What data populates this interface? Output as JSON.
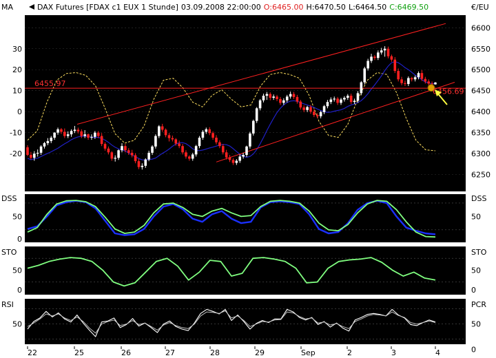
{
  "header": {
    "symbol": "DAX Futures [FDAX c1 EUX  1 Stunde]",
    "datetime": "03.09.2008 22:00:00",
    "open": "O:6465.00",
    "high": "H:6470.50",
    "low": "L:6464.50",
    "close": "C:6469.50"
  },
  "colors": {
    "panel_bg": "#000000",
    "candle_up": "#ffffff",
    "candle_down": "#ff2020",
    "channel": "#ff2020",
    "ma_blue": "#2020c8",
    "osc_dashed": "#ffe060",
    "osc_green": "#80ff80",
    "dss_blue": "#1a30ff",
    "arrow": "#ffff40",
    "highlight": "#e0a000"
  },
  "chart_data": [
    {
      "type": "line",
      "panel": "price",
      "left_axis_label": "MA",
      "right_axis_label": "€/EU",
      "left_ticks": [
        30,
        20,
        10,
        0,
        -10,
        -20
      ],
      "right_ticks": [
        6600,
        6550,
        6500,
        6450,
        6400,
        6350,
        6300,
        6250
      ],
      "ylim": [
        6210,
        6630
      ],
      "x_tick_labels": [
        "22",
        "25",
        "26",
        "27",
        "28",
        "29",
        "Sep",
        "2",
        "3",
        "4"
      ],
      "horizontal_line": {
        "value": 6455.97,
        "label": "6455.97"
      },
      "marker": {
        "value": 6456.69,
        "label": "6456.69"
      },
      "channel": {
        "upper": [
          [
            112,
            6370
          ],
          [
            647,
            6610
          ]
        ],
        "lower": [
          [
            314,
            6280
          ],
          [
            660,
            6470
          ]
        ]
      },
      "candles": {
        "o": [
          6315,
          6297,
          6290,
          6300,
          6302,
          6317,
          6325,
          6330,
          6338,
          6350,
          6358,
          6352,
          6342,
          6346,
          6354,
          6357,
          6353,
          6342,
          6346,
          6338,
          6340,
          6350,
          6342,
          6323,
          6312,
          6303,
          6288,
          6290,
          6308,
          6318,
          6308,
          6302,
          6296,
          6282,
          6268,
          6271,
          6286,
          6302,
          6317,
          6342,
          6365,
          6357,
          6344,
          6337,
          6334,
          6324,
          6318,
          6303,
          6293,
          6288,
          6298,
          6318,
          6338,
          6352,
          6358,
          6349,
          6338,
          6327,
          6318,
          6303,
          6291,
          6285,
          6278,
          6283,
          6293,
          6297,
          6317,
          6348,
          6378,
          6408,
          6427,
          6438,
          6442,
          6433,
          6436,
          6430,
          6421,
          6427,
          6436,
          6442,
          6435,
          6424,
          6410,
          6404,
          6411,
          6400,
          6392,
          6389,
          6399,
          6413,
          6423,
          6429,
          6431,
          6421,
          6429,
          6433,
          6438,
          6423,
          6426,
          6444,
          6470,
          6503,
          6521,
          6531,
          6528,
          6541,
          6546,
          6550,
          6532,
          6524,
          6497,
          6477,
          6468,
          6466,
          6480,
          6477,
          6482,
          6492,
          6478,
          6472,
          6467,
          6465
        ],
        "h": [
          6320,
          6304,
          6306,
          6310,
          6320,
          6328,
          6337,
          6342,
          6351,
          6362,
          6361,
          6360,
          6353,
          6358,
          6366,
          6362,
          6358,
          6356,
          6348,
          6346,
          6354,
          6354,
          6349,
          6327,
          6317,
          6306,
          6296,
          6310,
          6325,
          6323,
          6313,
          6309,
          6301,
          6288,
          6277,
          6289,
          6307,
          6320,
          6346,
          6368,
          6371,
          6360,
          6349,
          6343,
          6337,
          6331,
          6323,
          6308,
          6296,
          6302,
          6321,
          6342,
          6356,
          6362,
          6363,
          6353,
          6344,
          6332,
          6323,
          6309,
          6297,
          6289,
          6287,
          6298,
          6302,
          6319,
          6352,
          6381,
          6411,
          6430,
          6443,
          6447,
          6446,
          6441,
          6440,
          6435,
          6432,
          6440,
          6448,
          6447,
          6440,
          6428,
          6415,
          6414,
          6416,
          6406,
          6396,
          6402,
          6416,
          6428,
          6434,
          6436,
          6435,
          6433,
          6437,
          6442,
          6443,
          6431,
          6449,
          6473,
          6507,
          6526,
          6538,
          6535,
          6546,
          6552,
          6556,
          6555,
          6536,
          6530,
          6503,
          6483,
          6474,
          6484,
          6483,
          6486,
          6496,
          6499,
          6483,
          6477,
          6472,
          6470.5
        ],
        "l": [
          6294,
          6286,
          6283,
          6293,
          6297,
          6312,
          6320,
          6325,
          6333,
          6345,
          6347,
          6337,
          6337,
          6340,
          6349,
          6348,
          6337,
          6337,
          6333,
          6333,
          6335,
          6337,
          6318,
          6307,
          6298,
          6283,
          6281,
          6285,
          6303,
          6303,
          6297,
          6291,
          6277,
          6263,
          6262,
          6266,
          6282,
          6297,
          6312,
          6337,
          6352,
          6339,
          6329,
          6329,
          6319,
          6313,
          6298,
          6288,
          6283,
          6283,
          6293,
          6313,
          6333,
          6347,
          6344,
          6333,
          6322,
          6313,
          6298,
          6286,
          6280,
          6273,
          6273,
          6278,
          6288,
          6292,
          6312,
          6343,
          6373,
          6403,
          6422,
          6428,
          6427,
          6428,
          6425,
          6416,
          6416,
          6422,
          6431,
          6430,
          6419,
          6405,
          6399,
          6399,
          6395,
          6387,
          6384,
          6384,
          6394,
          6408,
          6418,
          6424,
          6416,
          6416,
          6424,
          6428,
          6418,
          6418,
          6421,
          6439,
          6465,
          6498,
          6516,
          6523,
          6523,
          6536,
          6531,
          6527,
          6519,
          6492,
          6472,
          6463,
          6461,
          6461,
          6472,
          6472,
          6477,
          6473,
          6467,
          6462,
          6460,
          6464.5
        ],
        "c": [
          6297,
          6290,
          6300,
          6302,
          6317,
          6325,
          6330,
          6338,
          6350,
          6358,
          6352,
          6342,
          6346,
          6354,
          6357,
          6353,
          6342,
          6346,
          6338,
          6340,
          6350,
          6342,
          6323,
          6312,
          6303,
          6288,
          6290,
          6308,
          6318,
          6308,
          6302,
          6296,
          6282,
          6268,
          6271,
          6286,
          6302,
          6317,
          6342,
          6365,
          6357,
          6344,
          6337,
          6334,
          6324,
          6318,
          6303,
          6293,
          6288,
          6298,
          6318,
          6338,
          6352,
          6358,
          6349,
          6338,
          6327,
          6318,
          6303,
          6291,
          6285,
          6278,
          6283,
          6293,
          6297,
          6317,
          6348,
          6378,
          6408,
          6427,
          6438,
          6442,
          6433,
          6436,
          6430,
          6421,
          6427,
          6436,
          6442,
          6435,
          6424,
          6410,
          6404,
          6411,
          6400,
          6392,
          6389,
          6399,
          6413,
          6423,
          6429,
          6431,
          6421,
          6429,
          6433,
          6438,
          6423,
          6426,
          6444,
          6470,
          6503,
          6521,
          6531,
          6528,
          6541,
          6546,
          6550,
          6532,
          6524,
          6497,
          6477,
          6468,
          6466,
          6480,
          6477,
          6482,
          6492,
          6478,
          6472,
          6467,
          6465,
          6469.5
        ]
      }
    },
    {
      "type": "line",
      "panel": "dss",
      "left_axis_label": "DSS",
      "right_axis_label": "DSS",
      "left_ticks": [
        50,
        0
      ],
      "right_ticks": [
        50
      ],
      "ylim": [
        -8,
        100
      ],
      "series": [
        {
          "color": "#1a30ff",
          "width": 2.4,
          "values": [
            22,
            28,
            50,
            75,
            82,
            85,
            82,
            68,
            40,
            12,
            8,
            10,
            22,
            50,
            72,
            78,
            66,
            45,
            38,
            55,
            62,
            45,
            35,
            38,
            70,
            82,
            84,
            82,
            78,
            55,
            22,
            12,
            15,
            35,
            65,
            80,
            85,
            80,
            50,
            25,
            18,
            12,
            10
          ]
        },
        {
          "color": "#80ff80",
          "width": 1.8,
          "values": [
            15,
            25,
            55,
            78,
            85,
            86,
            83,
            72,
            48,
            22,
            12,
            15,
            30,
            58,
            78,
            80,
            70,
            55,
            50,
            62,
            68,
            58,
            50,
            52,
            72,
            84,
            86,
            84,
            80,
            62,
            35,
            20,
            18,
            32,
            58,
            78,
            86,
            84,
            65,
            38,
            15,
            5,
            4
          ]
        }
      ]
    },
    {
      "type": "line",
      "panel": "sto",
      "left_axis_label": "STO",
      "right_axis_label": "STO",
      "left_ticks": [
        50,
        0
      ],
      "right_ticks": [
        50,
        0
      ],
      "ylim": [
        -12,
        110
      ],
      "series": [
        {
          "color": "#80ff80",
          "width": 1.8,
          "values": [
            55,
            62,
            72,
            78,
            82,
            80,
            72,
            50,
            20,
            10,
            18,
            45,
            72,
            80,
            60,
            25,
            45,
            75,
            72,
            35,
            42,
            80,
            82,
            78,
            72,
            55,
            18,
            20,
            55,
            72,
            76,
            78,
            82,
            70,
            50,
            35,
            45,
            30,
            25
          ]
        }
      ]
    },
    {
      "type": "line",
      "panel": "rsi",
      "left_axis_label": "RSI",
      "right_axis_label": "PCR",
      "left_ticks": [
        50
      ],
      "right_ticks": [
        50,
        0
      ],
      "ylim": [
        10,
        100
      ],
      "series": [
        {
          "color": "#ffffff",
          "width": 1.1,
          "values": [
            40,
            55,
            62,
            75,
            64,
            72,
            60,
            54,
            68,
            52,
            38,
            25,
            54,
            56,
            62,
            43,
            49,
            61,
            46,
            52,
            43,
            33,
            50,
            56,
            45,
            40,
            37,
            52,
            71,
            79,
            75,
            70,
            79,
            57,
            68,
            55,
            40,
            51,
            57,
            53,
            60,
            60,
            79,
            74,
            63,
            58,
            63,
            49,
            55,
            44,
            52,
            42,
            36,
            58,
            63,
            69,
            71,
            69,
            66,
            79,
            68,
            62,
            49,
            47,
            53,
            58,
            54
          ]
        },
        {
          "color": "#c0c0c0",
          "width": 1.0,
          "values": [
            45,
            52,
            60,
            70,
            66,
            70,
            62,
            57,
            64,
            55,
            42,
            32,
            50,
            55,
            58,
            47,
            50,
            57,
            49,
            52,
            45,
            38,
            48,
            53,
            47,
            43,
            41,
            50,
            66,
            74,
            73,
            71,
            76,
            62,
            66,
            57,
            45,
            50,
            55,
            54,
            58,
            59,
            74,
            72,
            65,
            60,
            62,
            52,
            54,
            48,
            51,
            45,
            41,
            55,
            60,
            66,
            69,
            68,
            66,
            74,
            67,
            63,
            53,
            50,
            53,
            56,
            53
          ]
        }
      ]
    }
  ]
}
